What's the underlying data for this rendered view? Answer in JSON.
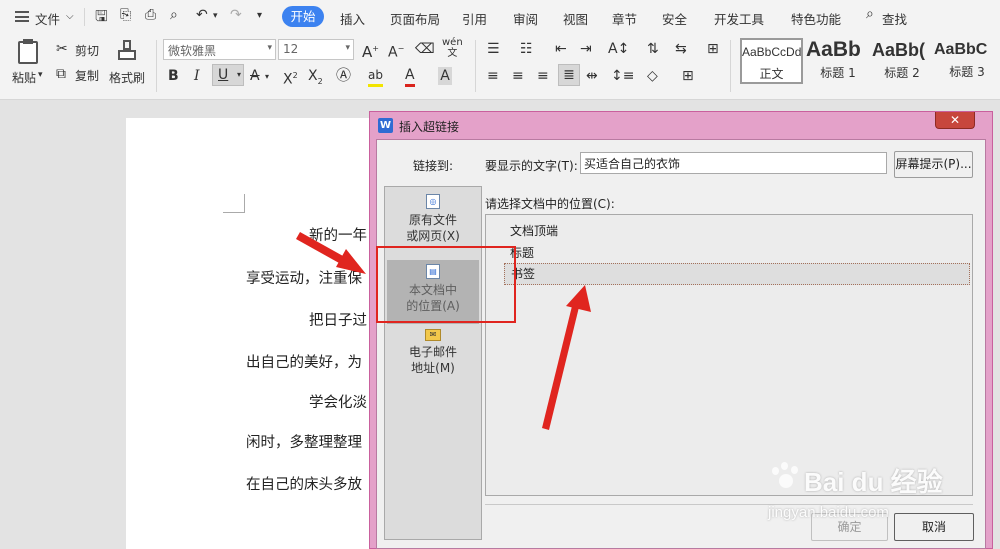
{
  "menubar": {
    "file_menu": "文件",
    "tabs": [
      "开始",
      "插入",
      "页面布局",
      "引用",
      "审阅",
      "视图",
      "章节",
      "安全",
      "开发工具",
      "特色功能"
    ],
    "search": "查找"
  },
  "ribbon": {
    "paste": "粘贴",
    "cut": "剪切",
    "copy": "复制",
    "format_painter": "格式刷",
    "font_name": "微软雅黑",
    "font_size": "12",
    "styles": [
      {
        "preview": "AaBbCcDd",
        "label": "正文"
      },
      {
        "preview": "AaBb",
        "label": "标题 1"
      },
      {
        "preview": "AaBb(",
        "label": "标题 2"
      },
      {
        "preview": "AaBbC",
        "label": "标题 3"
      }
    ]
  },
  "document": {
    "lines": [
      "新的一年",
      "享受运动，注重保",
      "把日子过",
      "出自己的美好，为",
      "学会化淡",
      "闲时，多整理整理",
      "在自己的床头多放"
    ]
  },
  "dialog": {
    "title": "插入超链接",
    "link_to_label": "链接到:",
    "display_text_label": "要显示的文字(T):",
    "display_text_value": "买适合自己的衣饰",
    "screen_tip_button": "屏幕提示(P)...",
    "nav_items": [
      {
        "line1": "原有文件",
        "line2": "或网页(X)"
      },
      {
        "line1": "本文档中",
        "line2": "的位置(A)"
      },
      {
        "line1": "电子邮件",
        "line2": "地址(M)"
      }
    ],
    "place_label": "请选择文档中的位置(C):",
    "places": [
      "文档顶端",
      "标题",
      "书签"
    ],
    "ok_button": "确定",
    "cancel_button": "取消"
  },
  "watermark": {
    "brand": "Bai du 经验",
    "url": "jingyan.baidu.com"
  },
  "colors": {
    "accent_blue": "#3c82f0",
    "dialog_border_pink": "#e4a1c9",
    "annotation_red": "#e0251f"
  }
}
